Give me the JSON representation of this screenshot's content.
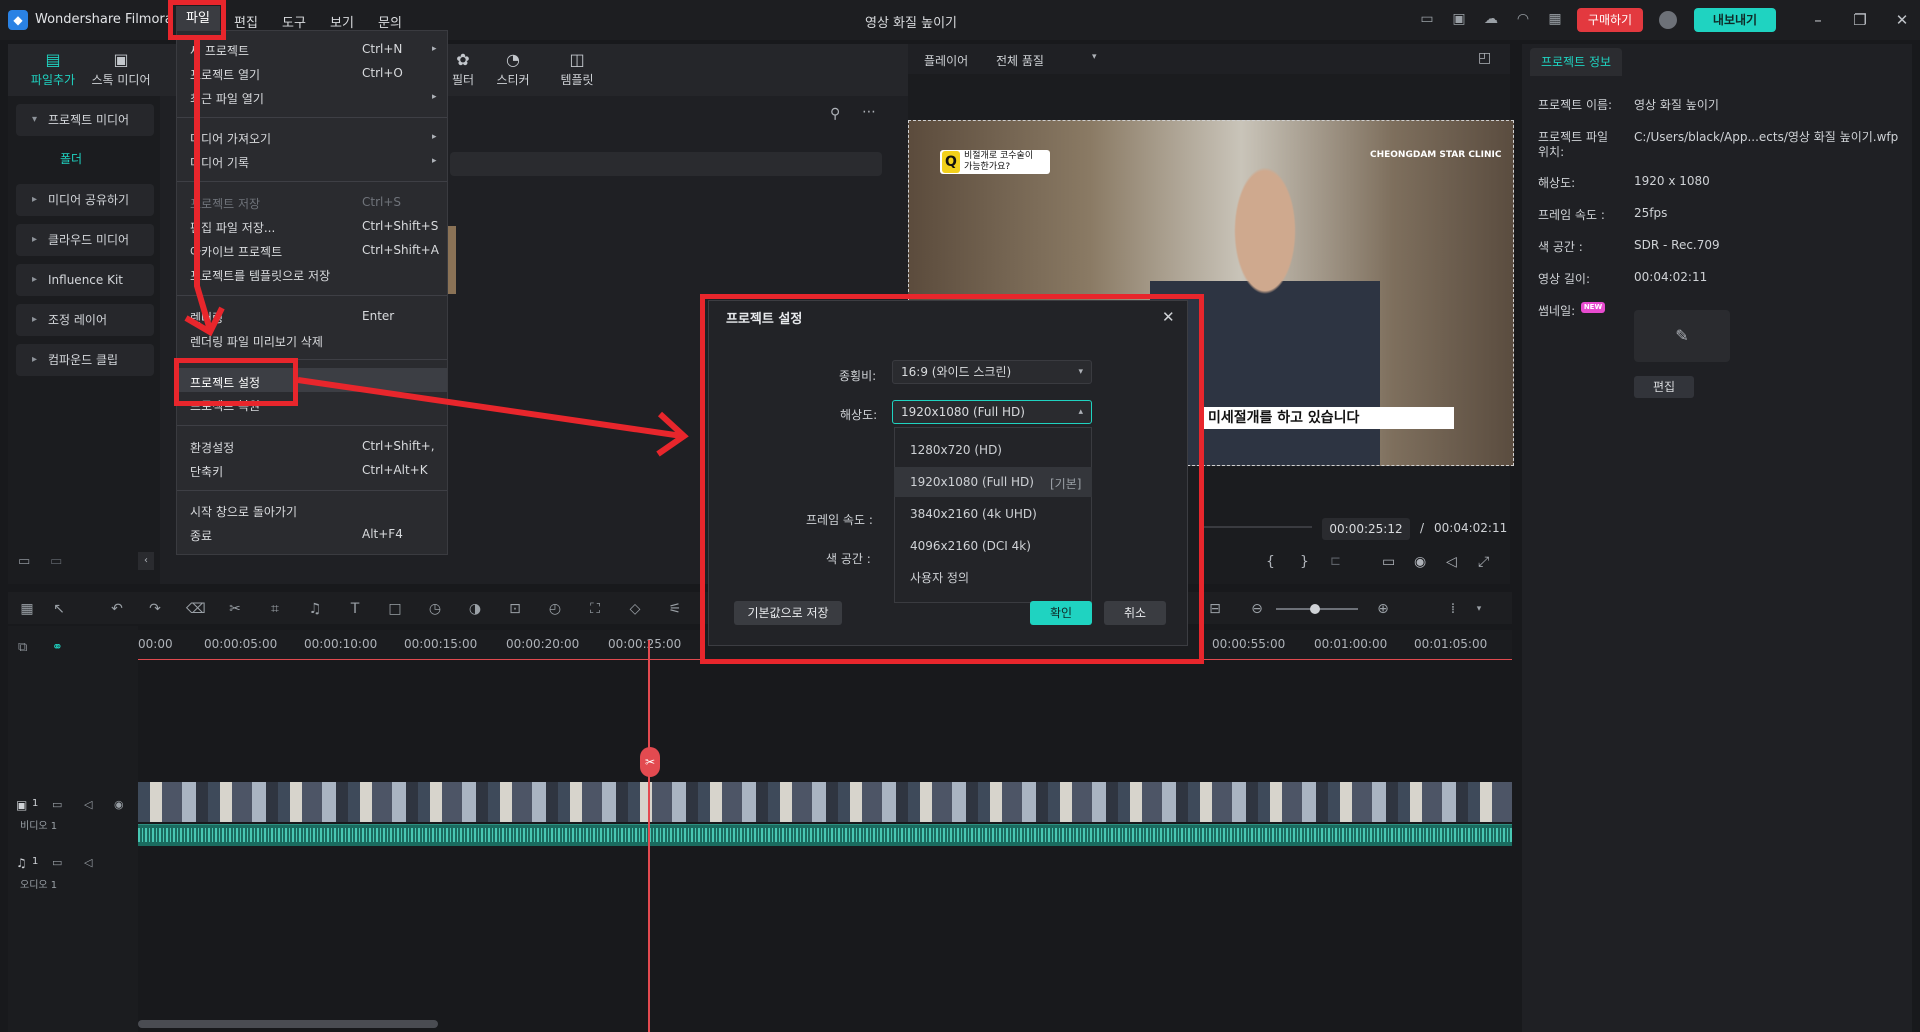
{
  "app": {
    "name": "Wondershare Filmora",
    "window_title": "영상 화질 높이기",
    "buy_label": "구매하기",
    "export_label": "내보내기"
  },
  "menubar": {
    "file": "파일",
    "edit": "편집",
    "tools": "도구",
    "view": "보기",
    "help": "문의"
  },
  "toolbar": {
    "import": "파일추가",
    "stock": "스톡 미디어",
    "filter": "필터",
    "sticker": "스티커",
    "template": "템플릿"
  },
  "sidebar": {
    "project_media": "프로젝트 미디어",
    "folder": "폴더",
    "shared_media": "미디어 공유하기",
    "cloud_media": "클라우드 미디어",
    "influence_kit": "Influence Kit",
    "adjustment_layer": "조정 레이어",
    "compound_clip": "컴파운드 클립"
  },
  "file_menu": {
    "items": [
      {
        "label": "새 프로젝트",
        "shortcut": "Ctrl+N",
        "submenu": true,
        "disabled": false
      },
      {
        "label": "프로젝트 열기",
        "shortcut": "Ctrl+O",
        "submenu": false,
        "disabled": false
      },
      {
        "label": "최근 파일 열기",
        "shortcut": "",
        "submenu": true,
        "disabled": false
      },
      {
        "label": "미디어 가져오기",
        "shortcut": "",
        "submenu": true,
        "disabled": false
      },
      {
        "label": "미디어 기록",
        "shortcut": "",
        "submenu": true,
        "disabled": false
      },
      {
        "label": "프로젝트 저장",
        "shortcut": "Ctrl+S",
        "submenu": false,
        "disabled": true
      },
      {
        "label": "편집 파일 저장...",
        "shortcut": "Ctrl+Shift+S",
        "submenu": false,
        "disabled": false
      },
      {
        "label": "아카이브 프로젝트",
        "shortcut": "Ctrl+Shift+A",
        "submenu": false,
        "disabled": false
      },
      {
        "label": "프로젝트를 템플릿으로 저장",
        "shortcut": "",
        "submenu": false,
        "disabled": false
      },
      {
        "label": "렌더링",
        "shortcut": "Enter",
        "submenu": false,
        "disabled": false
      },
      {
        "label": "렌더링 파일 미리보기 삭제",
        "shortcut": "",
        "submenu": false,
        "disabled": false
      },
      {
        "label": "프로젝트 설정",
        "shortcut": "",
        "submenu": false,
        "disabled": false
      },
      {
        "label": "프로젝트 복원",
        "shortcut": "",
        "submenu": false,
        "disabled": false
      },
      {
        "label": "환경설정",
        "shortcut": "Ctrl+Shift+,",
        "submenu": false,
        "disabled": false
      },
      {
        "label": "단축키",
        "shortcut": "Ctrl+Alt+K",
        "submenu": false,
        "disabled": false
      },
      {
        "label": "시작 창으로 돌아가기",
        "shortcut": "",
        "submenu": false,
        "disabled": false
      },
      {
        "label": "종료",
        "shortcut": "Alt+F4",
        "submenu": false,
        "disabled": false
      }
    ]
  },
  "player": {
    "label": "플레이어",
    "quality": "전체 품질",
    "caption": "미세절개를 하고 있습니다",
    "q_bubble_line1": "비절개로 코수술이",
    "q_bubble_line2": "가능한가요?",
    "clinic_logo": "CHEONGDAM STAR CLINIC",
    "current_time": "00:00:25:12",
    "separator": "/",
    "total_time": "00:04:02:11"
  },
  "project_info": {
    "tab": "프로젝트 정보",
    "name_label": "프로젝트 이름:",
    "name_value": "영상 화질 높이기",
    "path_label_1": "프로젝트 파일",
    "path_label_2": "위치:",
    "path_value": "C:/Users/black/App...ects/영상 화질 높이기.wfp",
    "res_label": "해상도:",
    "res_value": "1920 x 1080",
    "fps_label": "프레임 속도 :",
    "fps_value": "25fps",
    "color_label": "색 공간 :",
    "color_value": "SDR - Rec.709",
    "length_label": "영상 길이:",
    "length_value": "00:04:02:11",
    "thumb_label": "썸네일:",
    "new_badge": "NEW",
    "edit_button": "편집"
  },
  "timeline": {
    "ticks": [
      "00:00",
      "00:00:05:00",
      "00:00:10:00",
      "00:00:15:00",
      "00:00:20:00",
      "00:00:25:00",
      "00:00:55:00",
      "00:01:00:00",
      "00:01:05:00"
    ],
    "video_track_label": "비디오 1",
    "audio_track_label": "오디오 1",
    "video_track_num": "1",
    "audio_track_num": "1"
  },
  "modal": {
    "title": "프로젝트 설정",
    "aspect_label": "종횡비:",
    "aspect_value": "16:9 (와이드 스크린)",
    "res_label": "해상도:",
    "res_value": "1920x1080 (Full HD)",
    "fps_label": "프레임 속도 :",
    "color_label": "색 공간 :",
    "res_options": [
      "1280x720 (HD)",
      "1920x1080 (Full HD)",
      "3840x2160 (4k UHD)",
      "4096x2160 (DCI 4k)",
      "사용자 정의"
    ],
    "default_tag": "[기본]",
    "save_default": "기본값으로 저장",
    "ok": "확인",
    "cancel": "취소"
  },
  "colors": {
    "accent": "#1fd3c1",
    "annotation_red": "#e8262c",
    "buy": "#e3393f"
  }
}
